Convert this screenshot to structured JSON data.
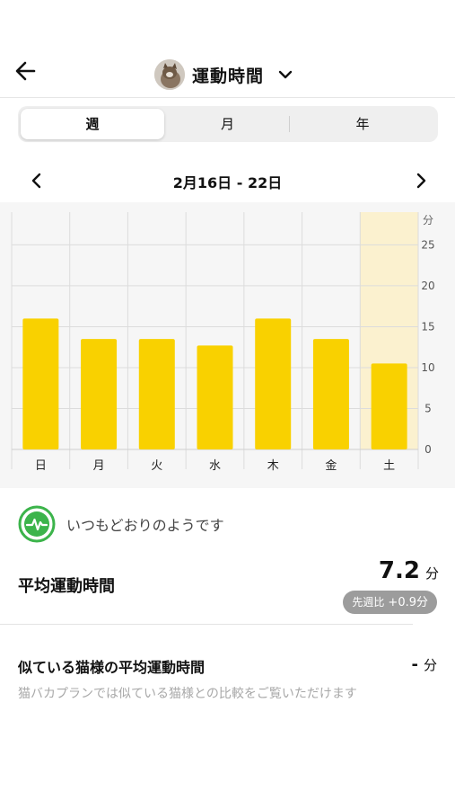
{
  "header": {
    "title": "運動時間"
  },
  "tabs": [
    {
      "label": "週",
      "active": true
    },
    {
      "label": "月",
      "active": false
    },
    {
      "label": "年",
      "active": false
    }
  ],
  "range": {
    "label": "2月16日 - 22日"
  },
  "colors": {
    "bar": "#f9d100",
    "highlight": "#fbf1cf",
    "status_green": "#3cb44b"
  },
  "chart_data": {
    "type": "bar",
    "categories": [
      "日",
      "月",
      "火",
      "水",
      "木",
      "金",
      "土"
    ],
    "values": [
      16,
      13.5,
      13.5,
      12.7,
      16,
      13.5,
      10.5
    ],
    "ylabel": "分",
    "yticks": [
      0,
      5,
      10,
      15,
      20,
      25
    ],
    "ylim": [
      0,
      29
    ],
    "highlight_category": "土",
    "grid": true
  },
  "status": {
    "text": "いつもどおりのようです",
    "icon": "heartbeat-icon"
  },
  "average": {
    "label": "平均運動時間",
    "value": "7.2",
    "unit": "分",
    "compare_label": "先週比",
    "compare_value": "+0.9分"
  },
  "similar": {
    "label": "似ている猫様の平均運動時間",
    "value": "-",
    "unit": "分",
    "note": "猫バカプランでは似ている猫様との比較をご覧いただけます"
  }
}
